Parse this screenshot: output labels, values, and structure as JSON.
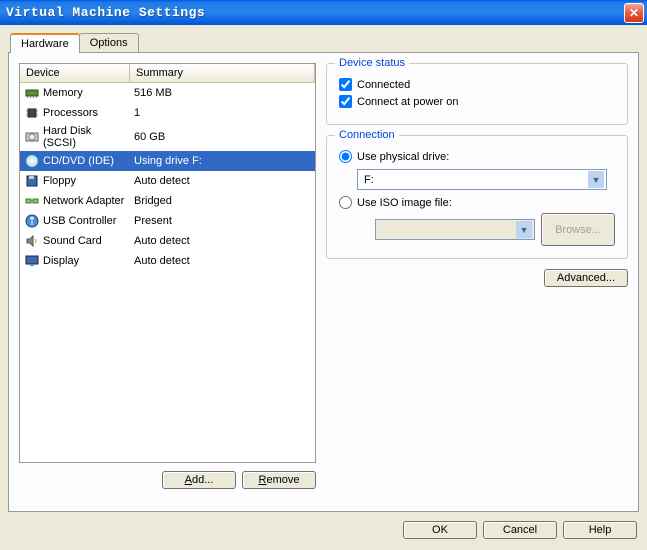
{
  "window": {
    "title": "Virtual Machine Settings"
  },
  "tabs": {
    "hardware": "Hardware",
    "options": "Options"
  },
  "list": {
    "header_device": "Device",
    "header_summary": "Summary",
    "rows": [
      {
        "device": "Memory",
        "summary": "516 MB"
      },
      {
        "device": "Processors",
        "summary": "1"
      },
      {
        "device": "Hard Disk (SCSI)",
        "summary": "60 GB"
      },
      {
        "device": "CD/DVD (IDE)",
        "summary": "Using drive F:"
      },
      {
        "device": "Floppy",
        "summary": "Auto detect"
      },
      {
        "device": "Network Adapter",
        "summary": "Bridged"
      },
      {
        "device": "USB Controller",
        "summary": "Present"
      },
      {
        "device": "Sound Card",
        "summary": "Auto detect"
      },
      {
        "device": "Display",
        "summary": "Auto detect"
      }
    ]
  },
  "buttons": {
    "add": "Add...",
    "remove": "Remove",
    "browse": "Browse...",
    "advanced": "Advanced...",
    "ok": "OK",
    "cancel": "Cancel",
    "help": "Help"
  },
  "device_status": {
    "title": "Device status",
    "connected": "Connected",
    "connect_power_on": "Connect at power on"
  },
  "connection": {
    "title": "Connection",
    "use_physical": "Use physical drive:",
    "physical_value": "F:",
    "use_iso": "Use ISO image file:",
    "iso_value": ""
  }
}
